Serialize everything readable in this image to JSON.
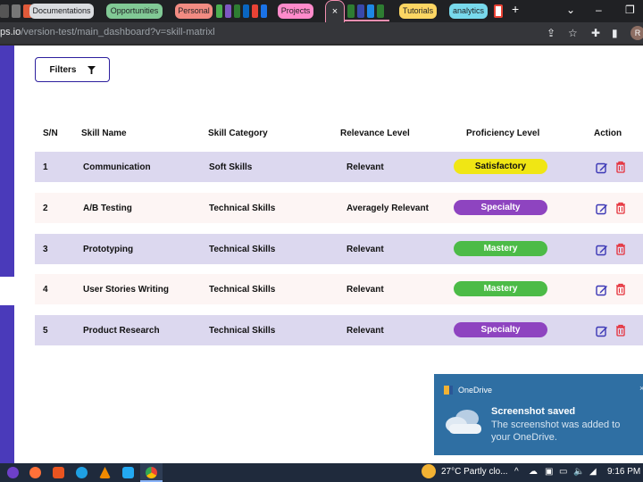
{
  "browser": {
    "tab_groups": [
      {
        "label": "Documentations",
        "color": "#dadce0"
      },
      {
        "label": "Opportunities",
        "color": "#81c995"
      },
      {
        "label": "Personal",
        "color": "#f28b82"
      },
      {
        "label": "Projects",
        "color": "#ff8bcb"
      },
      {
        "label": "Tutorials",
        "color": "#fdd663"
      },
      {
        "label": "analytics",
        "color": "#78d9ec"
      }
    ],
    "active_tab_close": "×",
    "new_tab": "+",
    "url_domain": "ps.io",
    "url_path": "/version-test/main_dashboard?v=skill-matrixl",
    "avatar_initial": "R"
  },
  "page": {
    "filters_label": "Filters",
    "table": {
      "headers": [
        "S/N",
        "Skill Name",
        "Skill Category",
        "Relevance Level",
        "Proficiency Level",
        "Action"
      ],
      "rows": [
        {
          "sn": "1",
          "name": "Communication",
          "category": "Soft Skills",
          "relevance": "Relevant",
          "proficiency": "Satisfactory",
          "badge_color": "#f0e614",
          "badge_text_color": "#111111"
        },
        {
          "sn": "2",
          "name": "A/B Testing",
          "category": "Technical Skills",
          "relevance": "Averagely Relevant",
          "proficiency": "Specialty",
          "badge_color": "#8e44c0",
          "badge_text_color": "#ffffff"
        },
        {
          "sn": "3",
          "name": "Prototyping",
          "category": "Technical Skills",
          "relevance": "Relevant",
          "proficiency": "Mastery",
          "badge_color": "#4cbb47",
          "badge_text_color": "#ffffff"
        },
        {
          "sn": "4",
          "name": "User Stories Writing",
          "category": "Technical Skills",
          "relevance": "Relevant",
          "proficiency": "Mastery",
          "badge_color": "#4cbb47",
          "badge_text_color": "#ffffff"
        },
        {
          "sn": "5",
          "name": "Product Research",
          "category": "Technical Skills",
          "relevance": "Relevant",
          "proficiency": "Specialty",
          "badge_color": "#8e44c0",
          "badge_text_color": "#ffffff"
        }
      ]
    }
  },
  "toast": {
    "app": "OneDrive",
    "title": "Screenshot saved",
    "message": "The screenshot was added to your OneDrive.",
    "close": "×"
  },
  "taskbar": {
    "weather": "27°C  Partly clo...",
    "time": "9:16 PM"
  }
}
